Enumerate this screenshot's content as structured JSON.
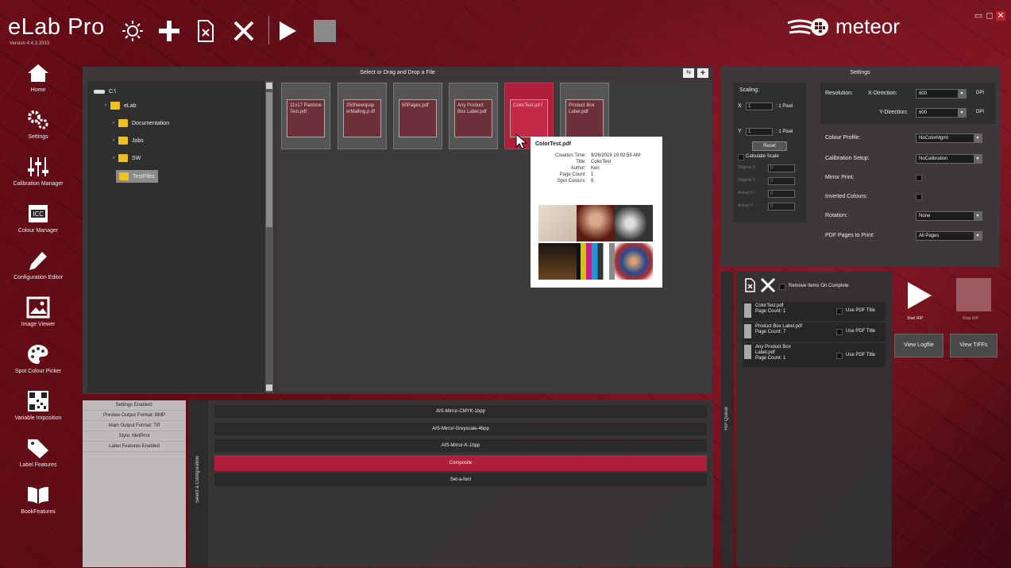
{
  "app": {
    "title": "eLab Pro",
    "version": "Version 4.4.3.3333",
    "brand": "meteor"
  },
  "toolbar": {
    "tools": [
      "settings-sun-icon",
      "add-icon",
      "delete-file-icon",
      "close-icon",
      "play-icon",
      "stop-icon"
    ]
  },
  "nav": [
    {
      "label": "Home",
      "icon": "home-icon"
    },
    {
      "label": "Settings",
      "icon": "gears-icon"
    },
    {
      "label": "Calibration Manager",
      "icon": "sliders-icon"
    },
    {
      "label": "Colour Manager",
      "icon": "icc-icon"
    },
    {
      "label": "Configuration Editor",
      "icon": "pencil-icon"
    },
    {
      "label": "Image Viewer",
      "icon": "image-icon"
    },
    {
      "label": "Spot Colour Picker",
      "icon": "palette-icon"
    },
    {
      "label": "Variable Imposition",
      "icon": "qr-icon"
    },
    {
      "label": "Label Features",
      "icon": "tag-icon"
    },
    {
      "label": "BookFeatures",
      "icon": "book-icon"
    }
  ],
  "file_browser": {
    "header": "Select or Drag and Drop a File",
    "tree": [
      {
        "label": "C:\\",
        "level": 0
      },
      {
        "label": "eLab",
        "level": 1
      },
      {
        "label": "Documentation",
        "level": 2
      },
      {
        "label": "Jobs",
        "level": 2
      },
      {
        "label": "SW",
        "level": 2
      },
      {
        "label": "TestFiles",
        "level": 2,
        "selected": true
      }
    ],
    "files": [
      {
        "name": "11x17 Pantone Test.pdf"
      },
      {
        "name": "250Newspap erMailing.p df"
      },
      {
        "name": "50Pages.pdf"
      },
      {
        "name": "Any Product Box Label.pdf"
      },
      {
        "name": "ColorTest.pd f",
        "active": true
      },
      {
        "name": "Product Box Label.pdf"
      }
    ],
    "tooltip": {
      "title": "ColorTest.pdf",
      "meta": [
        {
          "k": "Creation Time:",
          "v": "9/26/2019 10:02:59 AM"
        },
        {
          "k": "Title:",
          "v": "ColorTest"
        },
        {
          "k": "Author:",
          "v": "Ken"
        },
        {
          "k": "Page Count:",
          "v": "1"
        },
        {
          "k": "Spot Colours:",
          "v": "0"
        }
      ]
    }
  },
  "settings": {
    "title": "Settings",
    "scaling": {
      "title": "Scaling:",
      "x_label": "X",
      "x_value": "1",
      "x_unit": ": 1 Pixel",
      "y_label": "Y",
      "y_value": "1",
      "y_unit": ": 1 Pixel",
      "reset": "Reset",
      "calc_label": "Calculate Scale",
      "fields": [
        {
          "label": "Original X:",
          "value": "0"
        },
        {
          "label": "Original Y:",
          "value": "0"
        },
        {
          "label": "Actual X:",
          "value": "0"
        },
        {
          "label": "Actual Y:",
          "value": "0"
        }
      ]
    },
    "resolution": {
      "label": "Resolution:",
      "x_label": "X-Direction:",
      "x_value": "600",
      "x_unit": "DPI",
      "y_label": "Y-Direction:",
      "y_value": "600",
      "y_unit": "DPI"
    },
    "colour_profile": {
      "label": "Colour Profile:",
      "value": "NoColorMgmt"
    },
    "calibration": {
      "label": "Calibration Setup:",
      "value": "NoCalibration"
    },
    "mirror_label": "Mirror Print:",
    "inverted_label": "Inverted Colours:",
    "rotation": {
      "label": "Rotation:",
      "value": "None"
    },
    "pages": {
      "label": "PDF Pages to Print:",
      "value": "All Pages"
    }
  },
  "queue": {
    "remove_label": "Remove Items On Complete",
    "items": [
      {
        "name": "ColorTest.pdf",
        "pages": "Page Count: 1",
        "use_title": "Use PDF Title"
      },
      {
        "name": "Product Box Label.pdf",
        "pages": "Page Count: 7",
        "use_title": "Use PDF Title"
      },
      {
        "name": "Any Product Box Label.pdf",
        "pages": "Page Count: 1",
        "use_title": "Use PDF Title"
      }
    ],
    "strip_label": "RIP Queue",
    "start_label": "Start RIP",
    "stop_label": "Stop RIP",
    "view_log": "View Logfile",
    "view_tiffs": "View TIFFs"
  },
  "enabled": {
    "rows": [
      "Settings Enabled:",
      "Preview Output Format: BMP",
      "Main Output Format: Tiff",
      "Style: MetPrint",
      "Label Features Enabled"
    ]
  },
  "configs": {
    "strip_label": "Select a Configuration",
    "items": [
      {
        "name": "AIS-Mirror-CMYK-1bpp"
      },
      {
        "name": "AIS-Mirror-Greyscale-4bpp"
      },
      {
        "name": "AIS-Mirror-K-1bpp"
      },
      {
        "name": "Composite",
        "selected": true
      },
      {
        "name": "Set-a-font"
      }
    ]
  }
}
